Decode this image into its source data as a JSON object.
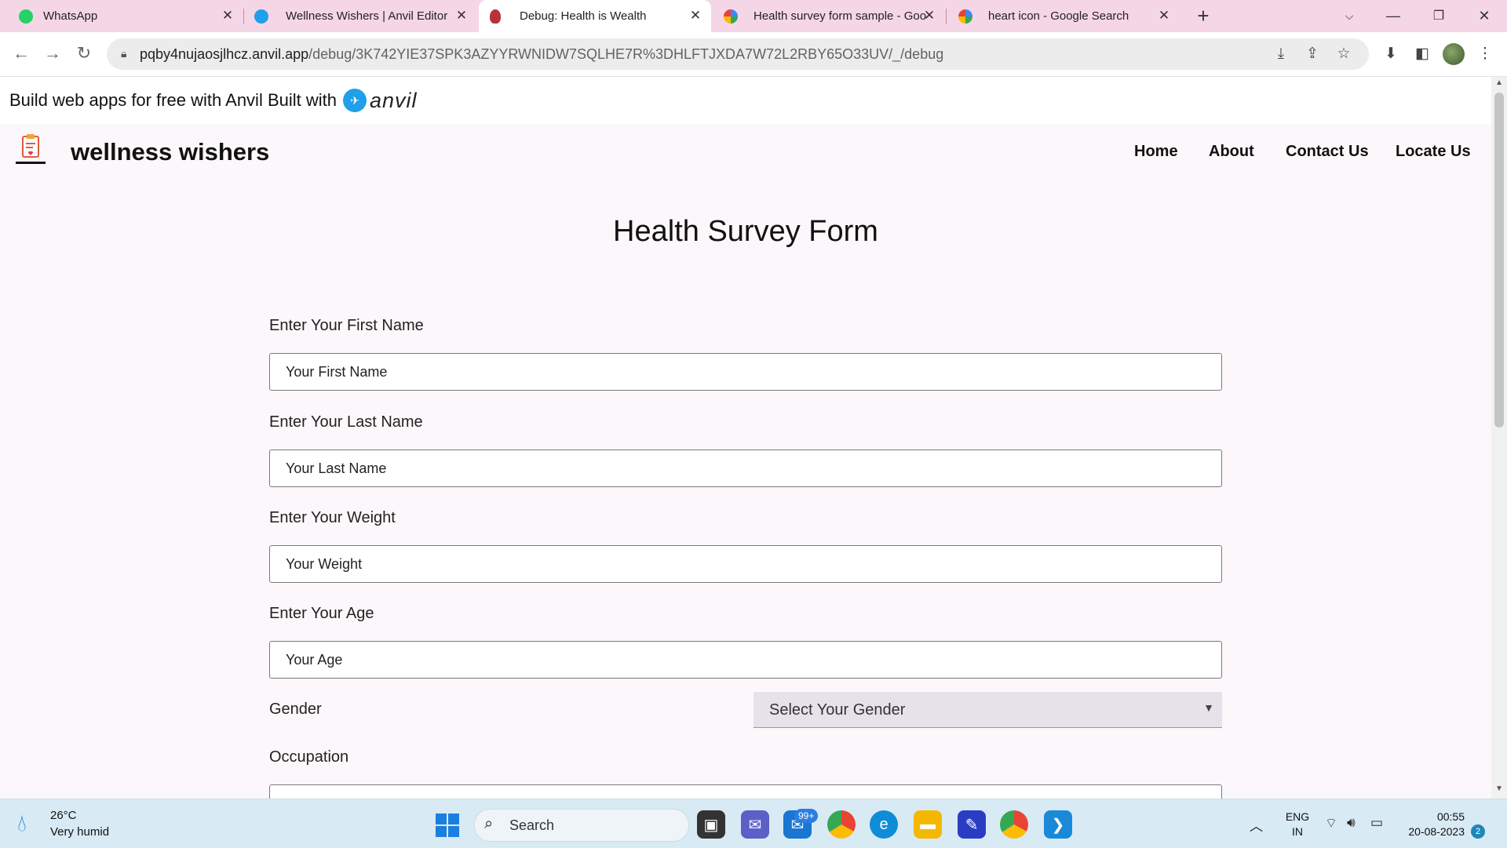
{
  "browser": {
    "tabs": [
      {
        "title": "WhatsApp",
        "active": false
      },
      {
        "title": "Wellness Wishers | Anvil Editor",
        "active": false
      },
      {
        "title": "Debug: Health is Wealth",
        "active": true
      },
      {
        "title": "Health survey form sample - Goo",
        "active": false
      },
      {
        "title": "heart icon - Google Search",
        "active": false
      }
    ],
    "new_tab": "+",
    "url_host": "pqby4nujaosjlhcz.anvil.app",
    "url_path": "/debug/3K742YIE37SPK3AZYYRWNIDW7SQLHE7R%3DHLFTJXDA7W72L2RBY65O33UV/_/debug"
  },
  "banner": {
    "text": "Build web apps for free with Anvil Built with",
    "brand": "anvil"
  },
  "site": {
    "title": "wellness wishers",
    "nav": [
      "Home",
      "About",
      "Contact Us",
      "Locate Us"
    ]
  },
  "form": {
    "title": "Health Survey Form",
    "first_name_label": "Enter Your First Name",
    "first_name_placeholder": "Your First Name",
    "last_name_label": "Enter Your Last Name",
    "last_name_placeholder": "Your Last Name",
    "weight_label": "Enter Your Weight",
    "weight_placeholder": "Your Weight",
    "age_label": "Enter Your Age",
    "age_placeholder": "Your Age",
    "gender_label": "Gender",
    "gender_select": "Select Your Gender",
    "occupation_label": "Occupation"
  },
  "taskbar": {
    "weather_temp": "26°C",
    "weather_desc": "Very humid",
    "search_label": "Search",
    "mail_badge": "99+",
    "lang_top": "ENG",
    "lang_bottom": "IN",
    "time": "00:55",
    "date": "20-08-2023",
    "notifications": "2"
  },
  "colors": {
    "tab_strip": "#f5d6e6",
    "page_bg": "#fcf7fa",
    "taskbar": "#d8eaf3",
    "anvil_blue": "#1fa0e8"
  }
}
